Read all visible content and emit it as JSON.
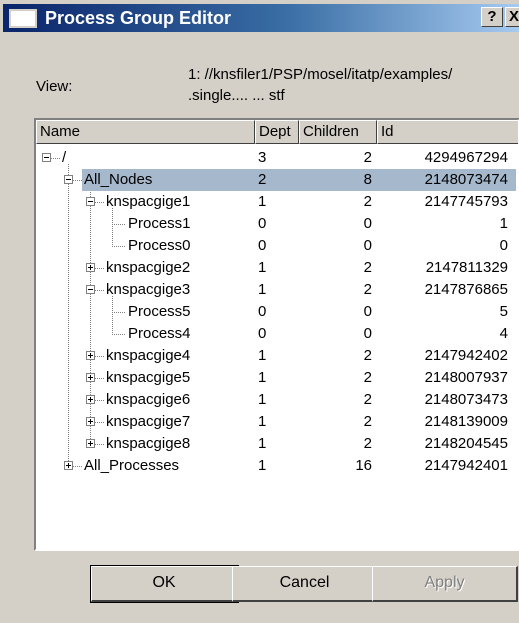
{
  "window": {
    "title": "Process Group Editor",
    "help_label": "?",
    "close_label": "X"
  },
  "view": {
    "label": "View:",
    "line1": "1: //knsfiler1/PSP/mosel/itatp/examples/",
    "line2": ".single.... ... stf"
  },
  "columns": [
    {
      "label": "Name"
    },
    {
      "label": "Dept"
    },
    {
      "label": "Children"
    },
    {
      "label": "Id"
    }
  ],
  "rows": [
    {
      "name": "/",
      "depth": "3",
      "children": "2",
      "id": "4294967294",
      "level": 0,
      "toggle": "minus",
      "selected": false
    },
    {
      "name": "All_Nodes",
      "depth": "2",
      "children": "8",
      "id": "2148073474",
      "level": 1,
      "toggle": "minus",
      "selected": true
    },
    {
      "name": "knspacgige1",
      "depth": "1",
      "children": "2",
      "id": "2147745793",
      "level": 2,
      "toggle": "minus",
      "selected": false
    },
    {
      "name": "Process1",
      "depth": "0",
      "children": "0",
      "id": "1",
      "level": 3,
      "toggle": "none",
      "selected": false
    },
    {
      "name": "Process0",
      "depth": "0",
      "children": "0",
      "id": "0",
      "level": 3,
      "toggle": "none",
      "selected": false
    },
    {
      "name": "knspacgige2",
      "depth": "1",
      "children": "2",
      "id": "2147811329",
      "level": 2,
      "toggle": "plus",
      "selected": false
    },
    {
      "name": "knspacgige3",
      "depth": "1",
      "children": "2",
      "id": "2147876865",
      "level": 2,
      "toggle": "minus",
      "selected": false
    },
    {
      "name": "Process5",
      "depth": "0",
      "children": "0",
      "id": "5",
      "level": 3,
      "toggle": "none",
      "selected": false
    },
    {
      "name": "Process4",
      "depth": "0",
      "children": "0",
      "id": "4",
      "level": 3,
      "toggle": "none",
      "selected": false
    },
    {
      "name": "knspacgige4",
      "depth": "1",
      "children": "2",
      "id": "2147942402",
      "level": 2,
      "toggle": "plus",
      "selected": false
    },
    {
      "name": "knspacgige5",
      "depth": "1",
      "children": "2",
      "id": "2148007937",
      "level": 2,
      "toggle": "plus",
      "selected": false
    },
    {
      "name": "knspacgige6",
      "depth": "1",
      "children": "2",
      "id": "2148073473",
      "level": 2,
      "toggle": "plus",
      "selected": false
    },
    {
      "name": "knspacgige7",
      "depth": "1",
      "children": "2",
      "id": "2148139009",
      "level": 2,
      "toggle": "plus",
      "selected": false
    },
    {
      "name": "knspacgige8",
      "depth": "1",
      "children": "2",
      "id": "2148204545",
      "level": 2,
      "toggle": "plus",
      "selected": false
    },
    {
      "name": "All_Processes",
      "depth": "1",
      "children": "16",
      "id": "2147942401",
      "level": 1,
      "toggle": "plus",
      "selected": false
    }
  ],
  "buttons": {
    "ok": "OK",
    "cancel": "Cancel",
    "apply": "Apply"
  },
  "colors": {
    "titlebar_start": "#0a246a",
    "titlebar_end": "#a6caf0",
    "selection": "#a6b8cc",
    "face": "#d4d0c8"
  }
}
